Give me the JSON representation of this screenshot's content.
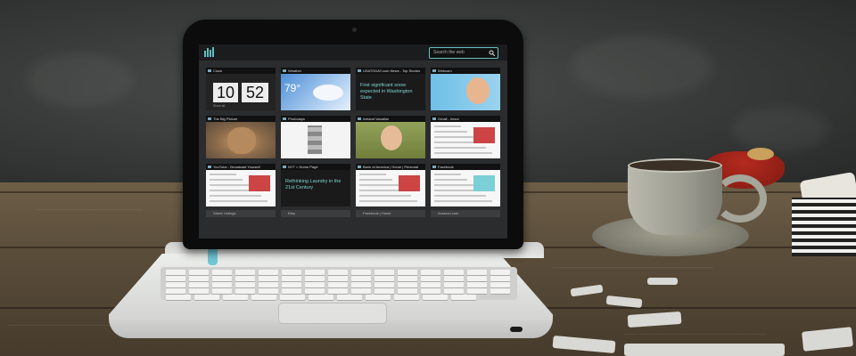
{
  "screen": {
    "search_placeholder": "Search the web",
    "tiles": [
      {
        "title": "Clock",
        "kind": "clock",
        "hour": "10",
        "minute": "52",
        "sub": "Show all"
      },
      {
        "title": "Weather",
        "kind": "weather",
        "temp": "79°"
      },
      {
        "title": "USATODAY.com News - Top Stories",
        "kind": "text",
        "text": "First significant snow expected in Washington State"
      },
      {
        "title": "Webcam",
        "kind": "photo-kid"
      },
      {
        "title": "The Big Picture",
        "kind": "photo-cat"
      },
      {
        "title": "Photodays",
        "kind": "photo-gallery"
      },
      {
        "title": "Iceland Vacation",
        "kind": "photo-child"
      },
      {
        "title": "Gmail - Inbox",
        "kind": "webpage"
      },
      {
        "title": "YouTube - Broadcast Yourself",
        "kind": "webpage"
      },
      {
        "title": "NYT > Home Page",
        "kind": "text",
        "text": "Rethinking Laundry in the 21st Century"
      },
      {
        "title": "Bank of America | Home | Personal",
        "kind": "webpage"
      },
      {
        "title": "Facebook",
        "kind": "webpage-robot"
      }
    ],
    "footer": [
      "Street Listings",
      "Etsy",
      "Facebook | Home",
      "Amazon.com"
    ]
  },
  "colors": {
    "accent": "#62c3c3",
    "tile_text": "#7fd3d0",
    "lid": "#0c0c0d",
    "cyan_tab": "#72c8d6"
  }
}
